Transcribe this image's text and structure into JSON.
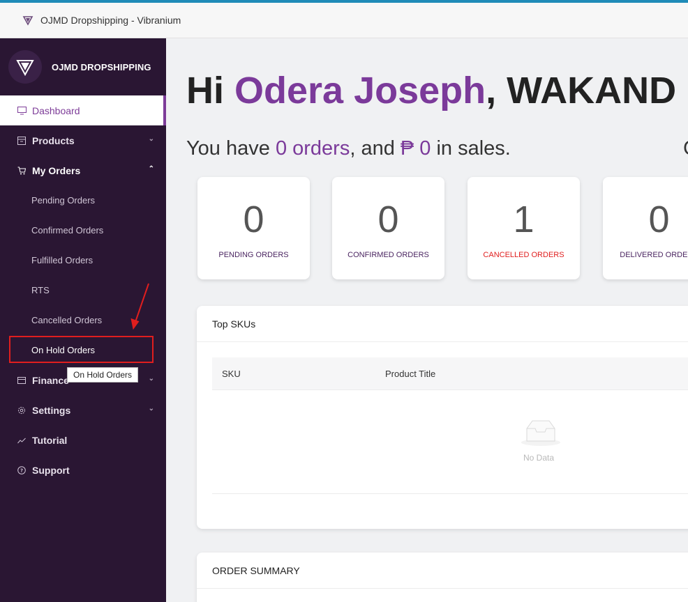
{
  "window": {
    "title": "OJMD Dropshipping - Vibranium"
  },
  "sidebar": {
    "brand": "OJMD DROPSHIPPING",
    "items": [
      {
        "label": "Dashboard",
        "icon": "monitor-icon"
      },
      {
        "label": "Products",
        "icon": "box-icon"
      },
      {
        "label": "My Orders",
        "icon": "cart-icon"
      },
      {
        "label": "Pending Orders"
      },
      {
        "label": "Confirmed Orders"
      },
      {
        "label": "Fulfilled Orders"
      },
      {
        "label": "RTS"
      },
      {
        "label": "Cancelled Orders"
      },
      {
        "label": "On Hold Orders"
      },
      {
        "label": "Finance",
        "icon": "wallet-icon"
      },
      {
        "label": "Settings",
        "icon": "gear-icon"
      },
      {
        "label": "Tutorial",
        "icon": "trend-icon"
      },
      {
        "label": "Support",
        "icon": "help-icon"
      }
    ],
    "tooltip": "On Hold Orders"
  },
  "main": {
    "greeting_prefix": "Hi ",
    "greeting_name": "Odera Joseph",
    "greeting_suffix": ", WAKAND",
    "summary_prefix": "You have ",
    "summary_orders": "0 orders",
    "summary_mid": ", and ",
    "summary_sales": "₱ 0",
    "summary_suffix": " in sales.",
    "summary_clipped": "C",
    "cards": [
      {
        "value": "0",
        "label": "PENDING ORDERS"
      },
      {
        "value": "0",
        "label": "CONFIRMED ORDERS"
      },
      {
        "value": "1",
        "label": "CANCELLED ORDERS"
      },
      {
        "value": "0",
        "label": "DELIVERED ORDERS"
      }
    ],
    "top_skus": {
      "title": "Top SKUs",
      "columns": [
        "SKU",
        "Product Title"
      ],
      "empty_text": "No Data"
    },
    "order_summary": {
      "title": "ORDER SUMMARY"
    }
  },
  "colors": {
    "sidebar_bg": "#2a1633",
    "accent": "#7b3a9a",
    "danger": "#e01e1e"
  }
}
